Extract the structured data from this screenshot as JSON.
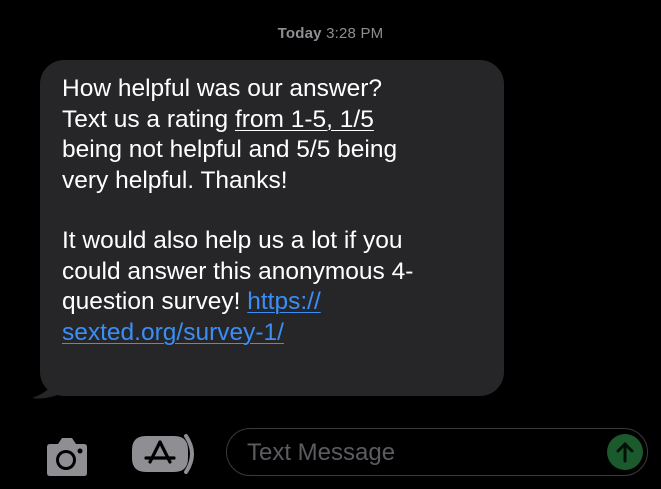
{
  "thread": {
    "timestamp_day": "Today",
    "timestamp_time": "3:28 PM"
  },
  "message": {
    "p1_line1": "How helpful was our answer?",
    "p1_line2_plain": "Text us a rating ",
    "p1_line2_underlined": "from 1-5, 1/5",
    "p1_line3": "being not helpful and 5/5 being",
    "p1_line4": "very helpful. Thanks!",
    "p2_line1": "It would also help us a lot if you",
    "p2_line2": "could answer this anonymous 4-",
    "p2_line3_plain": "question survey! ",
    "link_part1": "https://",
    "link_part2": "sexted.org/survey-1/"
  },
  "composer": {
    "placeholder": "Text Message",
    "camera_icon": "camera-icon",
    "apps_icon": "app-store-icon",
    "send_icon": "arrow-up-icon"
  },
  "colors": {
    "background": "#000000",
    "bubble": "#262628",
    "link": "#3a8ef6",
    "timestamp": "#8e8e93",
    "send_button": "#1a5a2c"
  }
}
